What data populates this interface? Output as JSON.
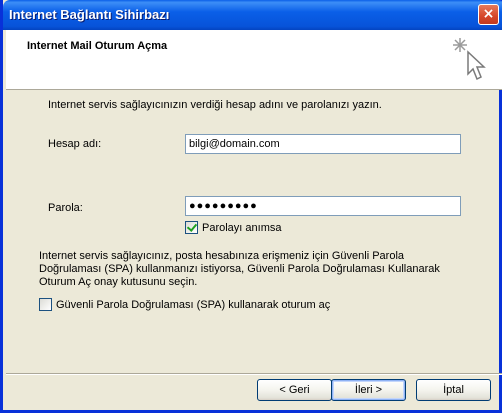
{
  "window": {
    "title": "Internet Bağlantı Sihirbazı",
    "close_label": "×"
  },
  "header": {
    "title": "Internet Mail Oturum Açma",
    "icon": "wizard-sparkle-cursor-icon"
  },
  "content": {
    "intro": "Internet servis sağlayıcınızın verdiği hesap adını ve parolanızı yazın.",
    "account_label": "Hesap adı:",
    "account_value": "bilgi@domain.com",
    "password_label": "Parola:",
    "password_value": "●●●●●●●●●",
    "remember_password_label": "Parolayı anımsa",
    "remember_password_checked": true,
    "spa_paragraph": "Internet servis sağlayıcınız, posta hesabınıza erişmeniz için Güvenli Parola Doğrulaması (SPA) kullanmanızı istiyorsa, Güvenli Parola Doğrulaması Kullanarak Oturum Aç onay kutusunu seçin.",
    "spa_label": "Güvenli Parola Doğrulaması (SPA) kullanarak oturum aç",
    "spa_checked": false
  },
  "buttons": {
    "back": "< Geri",
    "next": "İleri >",
    "cancel": "İptal"
  }
}
